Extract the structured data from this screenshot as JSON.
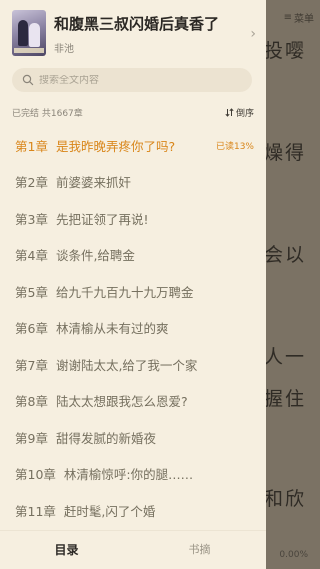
{
  "reader": {
    "menu_label": "菜单",
    "text_lines": [
      "投嘤",
      "燥得",
      "会以",
      "人一",
      "握住",
      "和欣"
    ],
    "progress": "0.00%"
  },
  "book": {
    "title": "和腹黑三叔闪婚后真香了",
    "author": "非池"
  },
  "search": {
    "placeholder": "搜索全文内容"
  },
  "meta": {
    "status": "已完结 共1667章",
    "sort_label": "倒序"
  },
  "chapters": [
    {
      "num": "第1章",
      "title": "是我昨晚弄疼你了吗?",
      "progress": "已读13%"
    },
    {
      "num": "第2章",
      "title": "前婆婆来抓奸"
    },
    {
      "num": "第3章",
      "title": "先把证领了再说!"
    },
    {
      "num": "第4章",
      "title": "谈条件,给聘金"
    },
    {
      "num": "第5章",
      "title": "给九千九百九十九万聘金"
    },
    {
      "num": "第6章",
      "title": "林清榆从未有过的爽"
    },
    {
      "num": "第7章",
      "title": "谢谢陆太太,给了我一个家"
    },
    {
      "num": "第8章",
      "title": "陆太太想跟我怎么恩爱?"
    },
    {
      "num": "第9章",
      "title": "甜得发腻的新婚夜"
    },
    {
      "num": "第10章",
      "title": "林清榆惊呼:你的腿……"
    },
    {
      "num": "第11章",
      "title": "赶时髦,闪了个婚"
    }
  ],
  "tabs": {
    "catalog": "目录",
    "bookmark": "书摘"
  },
  "colors": {
    "accent": "#d9861a",
    "drawer_bg": "#f6efe0"
  }
}
